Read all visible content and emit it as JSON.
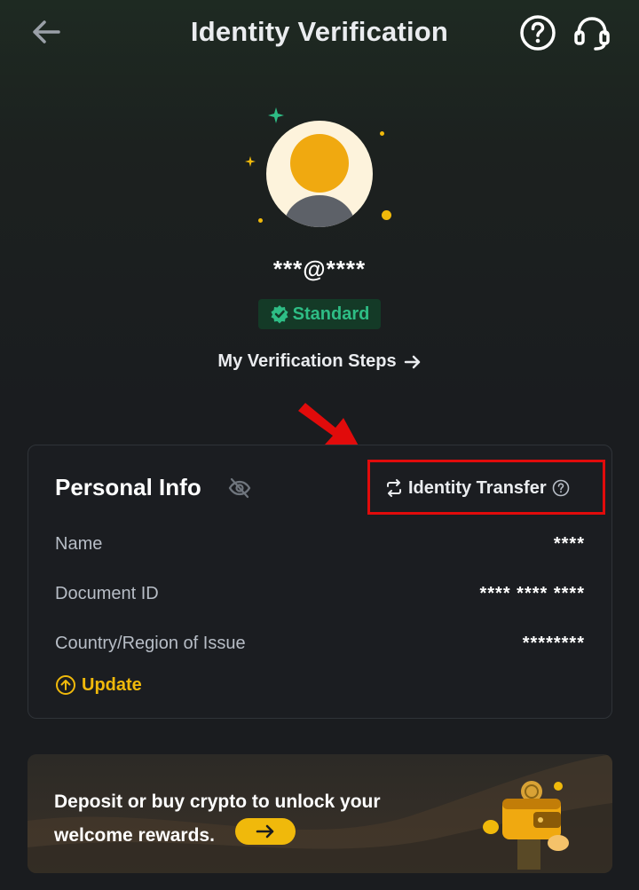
{
  "header": {
    "title": "Identity Verification",
    "back_icon": "arrow-left-icon",
    "help_icon": "question-circle-icon",
    "support_icon": "headset-icon"
  },
  "profile": {
    "email": "***@****",
    "badge_label": "Standard",
    "badge_color": "#2ebd85",
    "steps_link": "My Verification Steps"
  },
  "personal_info": {
    "title": "Personal Info",
    "transfer_label": "Identity Transfer",
    "rows": [
      {
        "label": "Name",
        "value": "****"
      },
      {
        "label": "Document ID",
        "value": "**** **** ****"
      },
      {
        "label": "Country/Region of Issue",
        "value": "********"
      }
    ],
    "update_label": "Update"
  },
  "promo": {
    "line1": "Deposit or buy crypto to unlock your",
    "line2": "welcome rewards."
  },
  "colors": {
    "accent": "#f0b90b",
    "annotation": "#e10b0b"
  }
}
